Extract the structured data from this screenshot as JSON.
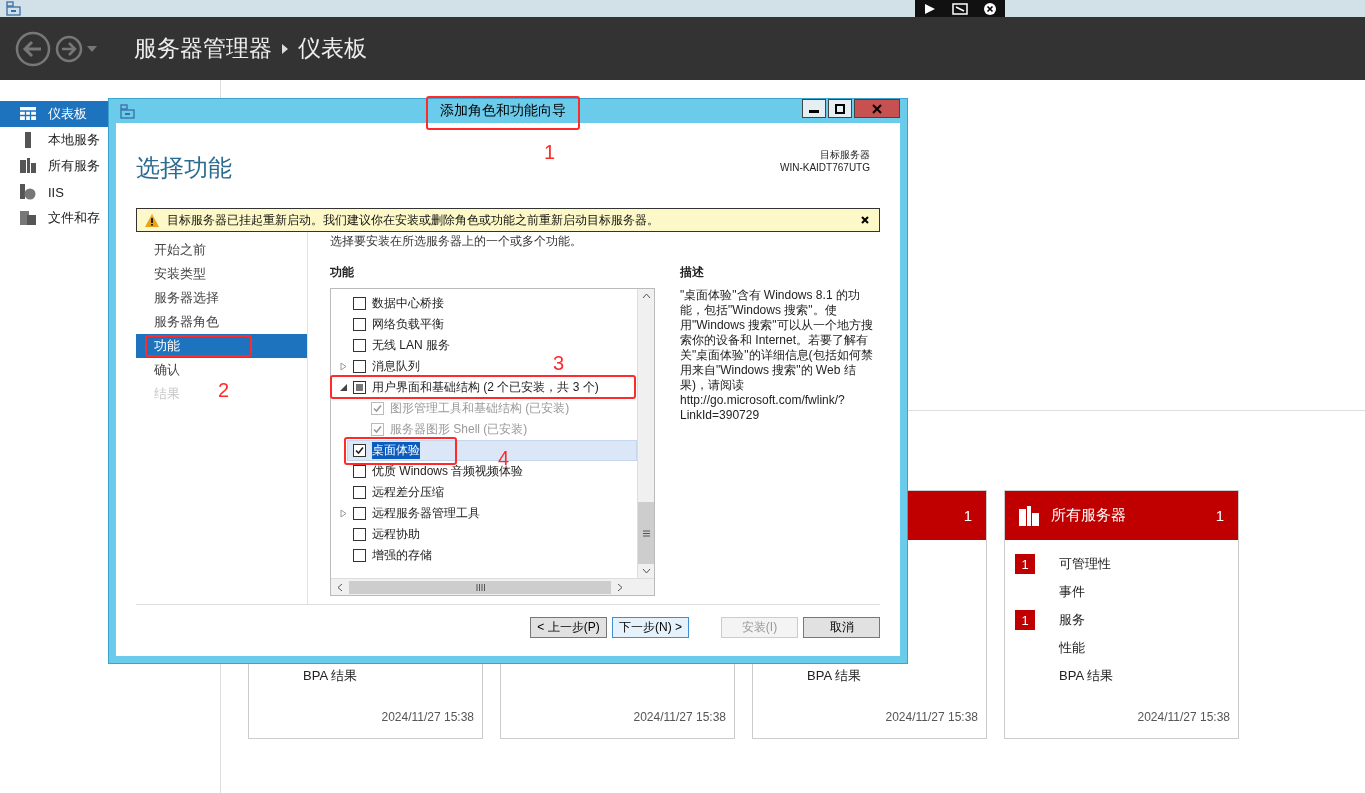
{
  "header": {
    "breadcrumb": [
      "服务器管理器",
      "仪表板"
    ]
  },
  "sidebar": {
    "items": [
      {
        "label": "仪表板",
        "kind": "dashboard",
        "selected": true
      },
      {
        "label": "本地服务",
        "kind": "server",
        "selected": false
      },
      {
        "label": "所有服务",
        "kind": "servers",
        "selected": false
      },
      {
        "label": "IIS",
        "kind": "iis",
        "selected": false
      },
      {
        "label": "文件和存",
        "kind": "files",
        "selected": false
      }
    ]
  },
  "tiles": [
    {
      "rows": [
        {
          "label": "BPA 结果"
        }
      ],
      "timestamp": "2024/11/27 15:38"
    },
    {
      "timestamp": "2024/11/27 15:38"
    },
    {
      "count": "1",
      "rows": [
        {
          "label": "BPA 结果"
        }
      ],
      "timestamp": "2024/11/27 15:38"
    },
    {
      "title": "所有服务器",
      "count": "1",
      "rows": [
        {
          "label": "可管理性",
          "badge": "1"
        },
        {
          "label": "事件"
        },
        {
          "label": "服务",
          "badge": "1"
        },
        {
          "label": "性能"
        },
        {
          "label": "BPA 结果"
        }
      ],
      "timestamp": "2024/11/27 15:38"
    }
  ],
  "dialog": {
    "title": "添加角色和功能向导",
    "heading": "选择功能",
    "target_label": "目标服务器",
    "target_server": "WIN-KAIDT767UTG",
    "warning": "目标服务器已挂起重新启动。我们建议你在安装或删除角色或功能之前重新启动目标服务器。",
    "steps": [
      {
        "label": "开始之前",
        "selected": false,
        "disabled": false
      },
      {
        "label": "安装类型",
        "selected": false,
        "disabled": false
      },
      {
        "label": "服务器选择",
        "selected": false,
        "disabled": false
      },
      {
        "label": "服务器角色",
        "selected": false,
        "disabled": false
      },
      {
        "label": "功能",
        "selected": true,
        "disabled": false
      },
      {
        "label": "确认",
        "selected": false,
        "disabled": false
      },
      {
        "label": "结果",
        "selected": false,
        "disabled": true
      }
    ],
    "instruction": "选择要安装在所选服务器上的一个或多个功能。",
    "features_label": "功能",
    "features": [
      {
        "label": "数据中心桥接",
        "checked": false,
        "indeterminate": false,
        "disabled": false,
        "selected": false
      },
      {
        "label": "网络负载平衡",
        "checked": false,
        "indeterminate": false,
        "disabled": false,
        "selected": false
      },
      {
        "label": "无线 LAN 服务",
        "checked": false,
        "indeterminate": false,
        "disabled": false,
        "selected": false
      },
      {
        "label": "消息队列",
        "checked": false,
        "indeterminate": false,
        "disabled": false,
        "selected": false,
        "expanded": false
      },
      {
        "label": "用户界面和基础结构 (2 个已安装，共 3 个)",
        "checked": false,
        "indeterminate": true,
        "disabled": false,
        "selected": false,
        "expanded": true,
        "children": [
          {
            "label": "图形管理工具和基础结构 (已安装)",
            "checked": true,
            "indeterminate": false,
            "disabled": true,
            "selected": false
          },
          {
            "label": "服务器图形 Shell (已安装)",
            "checked": true,
            "indeterminate": false,
            "disabled": true,
            "selected": false
          },
          {
            "label": "桌面体验",
            "checked": true,
            "indeterminate": false,
            "disabled": false,
            "selected": true
          }
        ]
      },
      {
        "label": "优质 Windows 音频视频体验",
        "checked": false,
        "indeterminate": false,
        "disabled": false,
        "selected": false
      },
      {
        "label": "远程差分压缩",
        "checked": false,
        "indeterminate": false,
        "disabled": false,
        "selected": false
      },
      {
        "label": "远程服务器管理工具",
        "checked": false,
        "indeterminate": false,
        "disabled": false,
        "selected": false,
        "expanded": false
      },
      {
        "label": "远程协助",
        "checked": false,
        "indeterminate": false,
        "disabled": false,
        "selected": false
      },
      {
        "label": "增强的存储",
        "checked": false,
        "indeterminate": false,
        "disabled": false,
        "selected": false
      }
    ],
    "description_label": "描述",
    "description": "\"桌面体验\"含有 Windows 8.1 的功能，包括\"Windows 搜索\"。使用\"Windows 搜索\"可以从一个地方搜索你的设备和 Internet。若要了解有关\"桌面体验\"的详细信息(包括如何禁用来自\"Windows 搜索\"的 Web 结果)，请阅读 http://go.microsoft.com/fwlink/?LinkId=390729",
    "buttons": [
      {
        "label": "< 上一步(P)",
        "disabled": false,
        "default": false
      },
      {
        "label": "下一步(N) >",
        "disabled": false,
        "default": true
      },
      {
        "label": "安装(I)",
        "disabled": true,
        "default": false
      },
      {
        "label": "取消",
        "disabled": false,
        "default": false
      }
    ]
  },
  "annotations": [
    {
      "label": "1"
    },
    {
      "label": "2"
    },
    {
      "label": "3"
    },
    {
      "label": "4"
    }
  ]
}
